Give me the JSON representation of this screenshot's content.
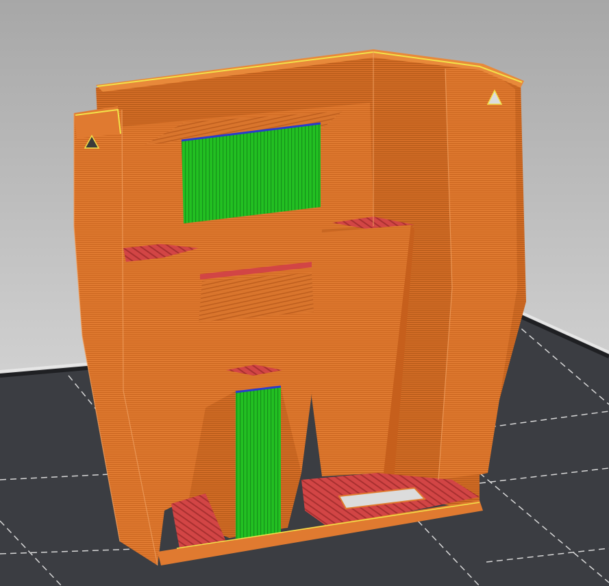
{
  "viewport": {
    "mode": "gcode-preview",
    "background_top": "#a9a9a9",
    "background_bottom": "#e6e6e6",
    "bed_color": "#3b3d42",
    "grid_line_color": "#ffffff",
    "bed_edge_color": "#262626"
  },
  "feature_colors": {
    "perimeter": "#e07a30",
    "external_perimeter": "#d96c28",
    "solid_infill": "#d24545",
    "top_solid_infill": "#cf3a3a",
    "bridge_infill": "#27c02a",
    "overhang_perimeter": "#2a3bcc",
    "gap_fill": "#f2e24a"
  },
  "object": {
    "name": "",
    "windows": [
      {
        "feature": "bridge_infill",
        "kind": "rectangular-window"
      },
      {
        "feature": "bridge_infill",
        "kind": "vertical-slot"
      }
    ]
  }
}
